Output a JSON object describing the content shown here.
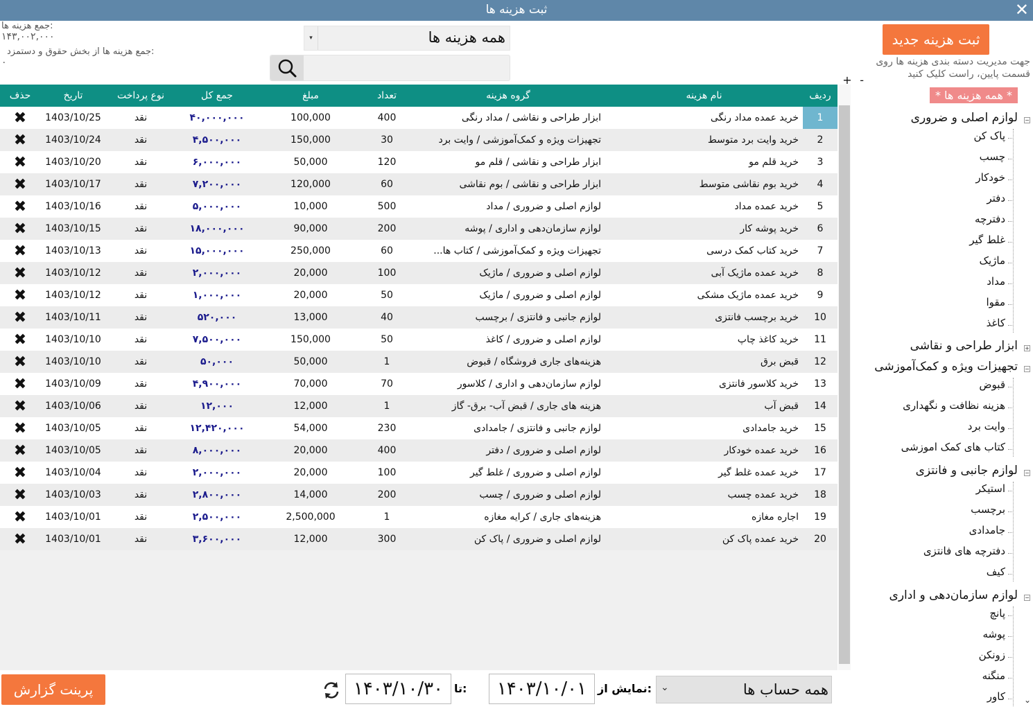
{
  "window": {
    "title": "ثبت هزینه ها",
    "close_glyph": "✕"
  },
  "totals": {
    "total_label": "جمع هزینه ها:",
    "total_value": "۱۴۳,۰۰۲,۰۰۰",
    "salary_label": "جمع هزینه ها از بخش حقوق و دستمزد:",
    "salary_value": "۰"
  },
  "filter": {
    "selected": "همه هزینه ها",
    "arrow": "▾"
  },
  "search": {
    "placeholder": "",
    "icon": "search-icon"
  },
  "table": {
    "headers": {
      "index": "ردیف",
      "name": "نام هزینه",
      "group": "گروه هزینه",
      "count": "تعداد",
      "amount": "مبلغ",
      "total": "جمع کل",
      "payment": "نوع پرداخت",
      "date": "تاریخ",
      "delete": "حذف"
    },
    "delete_glyph": "✖",
    "rows": [
      {
        "index": "1",
        "name": "خرید عمده مداد رنگی",
        "group": "ابزار طراحی و نقاشی / مداد رنگی",
        "count": "400",
        "amount": "100,000",
        "total": "۴۰,۰۰۰,۰۰۰",
        "payment": "نقد",
        "date": "1403/10/25"
      },
      {
        "index": "2",
        "name": "خرید وایت برد متوسط",
        "group": "تجهیزات ویژه و کمک‌آموزشی / وایت برد",
        "count": "30",
        "amount": "150,000",
        "total": "۴,۵۰۰,۰۰۰",
        "payment": "نقد",
        "date": "1403/10/24"
      },
      {
        "index": "3",
        "name": "خرید قلم مو",
        "group": "ابزار طراحی و نقاشی / قلم مو",
        "count": "120",
        "amount": "50,000",
        "total": "۶,۰۰۰,۰۰۰",
        "payment": "نقد",
        "date": "1403/10/20"
      },
      {
        "index": "4",
        "name": "خرید بوم نقاشی متوسط",
        "group": "ابزار طراحی و نقاشی / بوم نقاشی",
        "count": "60",
        "amount": "120,000",
        "total": "۷,۲۰۰,۰۰۰",
        "payment": "نقد",
        "date": "1403/10/17"
      },
      {
        "index": "5",
        "name": "خرید عمده مداد",
        "group": "لوازم اصلی و ضروری / مداد",
        "count": "500",
        "amount": "10,000",
        "total": "۵,۰۰۰,۰۰۰",
        "payment": "نقد",
        "date": "1403/10/16"
      },
      {
        "index": "6",
        "name": "خرید پوشه کار",
        "group": "لوازم سازمان‌دهی و اداری / پوشه",
        "count": "200",
        "amount": "90,000",
        "total": "۱۸,۰۰۰,۰۰۰",
        "payment": "نقد",
        "date": "1403/10/15"
      },
      {
        "index": "7",
        "name": "خرید کتاب کمک درسی",
        "group": "تجهیزات ویژه و کمک‌آموزشی / کتاب ها...",
        "count": "60",
        "amount": "250,000",
        "total": "۱۵,۰۰۰,۰۰۰",
        "payment": "نقد",
        "date": "1403/10/13"
      },
      {
        "index": "8",
        "name": "خرید عمده ماژیک آبی",
        "group": "لوازم اصلی و ضروری / ماژیک",
        "count": "100",
        "amount": "20,000",
        "total": "۲,۰۰۰,۰۰۰",
        "payment": "نقد",
        "date": "1403/10/12"
      },
      {
        "index": "9",
        "name": "خرید عمده ماژیک مشکی",
        "group": "لوازم اصلی و ضروری / ماژیک",
        "count": "50",
        "amount": "20,000",
        "total": "۱,۰۰۰,۰۰۰",
        "payment": "نقد",
        "date": "1403/10/12"
      },
      {
        "index": "10",
        "name": "خرید برچسب فانتزی",
        "group": "لوازم جانبی و فانتزی / برچسب",
        "count": "40",
        "amount": "13,000",
        "total": "۵۲۰,۰۰۰",
        "payment": "نقد",
        "date": "1403/10/11"
      },
      {
        "index": "11",
        "name": "خرید کاغذ چاپ",
        "group": "لوازم اصلی و ضروری / کاغذ",
        "count": "50",
        "amount": "150,000",
        "total": "۷,۵۰۰,۰۰۰",
        "payment": "نقد",
        "date": "1403/10/10"
      },
      {
        "index": "12",
        "name": "قبض برق",
        "group": "هزینه‌های جاری فروشگاه / قبوض",
        "count": "1",
        "amount": "50,000",
        "total": "۵۰,۰۰۰",
        "payment": "نقد",
        "date": "1403/10/10"
      },
      {
        "index": "13",
        "name": "خرید کلاسور فانتزی",
        "group": "لوازم سازمان‌دهی و اداری / کلاسور",
        "count": "70",
        "amount": "70,000",
        "total": "۴,۹۰۰,۰۰۰",
        "payment": "نقد",
        "date": "1403/10/09"
      },
      {
        "index": "14",
        "name": "قبض آب",
        "group": "هزینه های جاری / قبض آب- برق- گاز",
        "count": "1",
        "amount": "12,000",
        "total": "۱۲,۰۰۰",
        "payment": "نقد",
        "date": "1403/10/06"
      },
      {
        "index": "15",
        "name": "خرید جامدادی",
        "group": "لوازم جانبی و فانتزی / جامدادی",
        "count": "230",
        "amount": "54,000",
        "total": "۱۲,۴۲۰,۰۰۰",
        "payment": "نقد",
        "date": "1403/10/05"
      },
      {
        "index": "16",
        "name": "خرید عمده خودکار",
        "group": "لوازم اصلی و ضروری / دفتر",
        "count": "400",
        "amount": "20,000",
        "total": "۸,۰۰۰,۰۰۰",
        "payment": "نقد",
        "date": "1403/10/05"
      },
      {
        "index": "17",
        "name": "خرید عمده غلط گیر",
        "group": "لوازم اصلی و ضروری / غلط گیر",
        "count": "100",
        "amount": "20,000",
        "total": "۲,۰۰۰,۰۰۰",
        "payment": "نقد",
        "date": "1403/10/04"
      },
      {
        "index": "18",
        "name": "خرید عمده چسب",
        "group": "لوازم اصلی و ضروری / چسب",
        "count": "200",
        "amount": "14,000",
        "total": "۲,۸۰۰,۰۰۰",
        "payment": "نقد",
        "date": "1403/10/03"
      },
      {
        "index": "19",
        "name": "اجاره مغازه",
        "group": "هزینه‌های جاری / کرایه مغازه",
        "count": "1",
        "amount": "2,500,000",
        "total": "۲,۵۰۰,۰۰۰",
        "payment": "نقد",
        "date": "1403/10/01"
      },
      {
        "index": "20",
        "name": "خرید عمده پاک کن",
        "group": "لوازم اصلی و ضروری / پاک کن",
        "count": "300",
        "amount": "12,000",
        "total": "۳,۶۰۰,۰۰۰",
        "payment": "نقد",
        "date": "1403/10/01"
      }
    ]
  },
  "bottom": {
    "print_label": "پرینت گزارش",
    "to_label": "تا:",
    "to_value": "۱۴۰۳/۱۰/۳۰",
    "from_label": "نمایش از:",
    "from_value": "۱۴۰۳/۱۰/۰۱",
    "accounts_selected": "همه حساب ها",
    "accounts_arrow": "⌄",
    "refresh_icon": "refresh-icon"
  },
  "sidebar": {
    "new_button": "ثبت هزینه جدید",
    "hint": "جهت مدیریت دسته بندی هزینه ها روی قسمت پایین، راست کلیک کنید",
    "plus": "+",
    "minus": "-",
    "root": "* همه هزینه ها *",
    "groups": [
      {
        "label": "لوازم اصلی و ضروری",
        "expanded": true,
        "children": [
          "پاک کن",
          "چسب",
          "خودکار",
          "دفتر",
          "دفترچه",
          "غلط گیر",
          "ماژیک",
          "مداد",
          "مقوا",
          "کاغذ"
        ]
      },
      {
        "label": "ابزار طراحی و نقاشی",
        "expanded": false,
        "children": []
      },
      {
        "label": "تجهیزات ویژه و کمک‌آموزشی",
        "expanded": true,
        "children": [
          "قبوض",
          "هزینه نظافت و نگهداری",
          "وایت برد",
          "کتاب های کمک اموزشی"
        ]
      },
      {
        "label": "لوازم جانبی و فانتزی",
        "expanded": true,
        "children": [
          "استیکر",
          "برچسب",
          "جامدادی",
          "دفترچه های فانتزی",
          "کیف"
        ]
      },
      {
        "label": "لوازم سازمان‌دهی و اداری",
        "expanded": true,
        "children": [
          "پانچ",
          "پوشه",
          "زونکن",
          "منگنه",
          "کاور"
        ]
      }
    ]
  },
  "colors": {
    "titlebar": "#5f87a9",
    "header": "#0e8f84",
    "accent_button": "#f4773d",
    "selected_index": "#6fb6cf",
    "root_badge": "#f08a8a",
    "total_text": "#1a1a8c"
  }
}
